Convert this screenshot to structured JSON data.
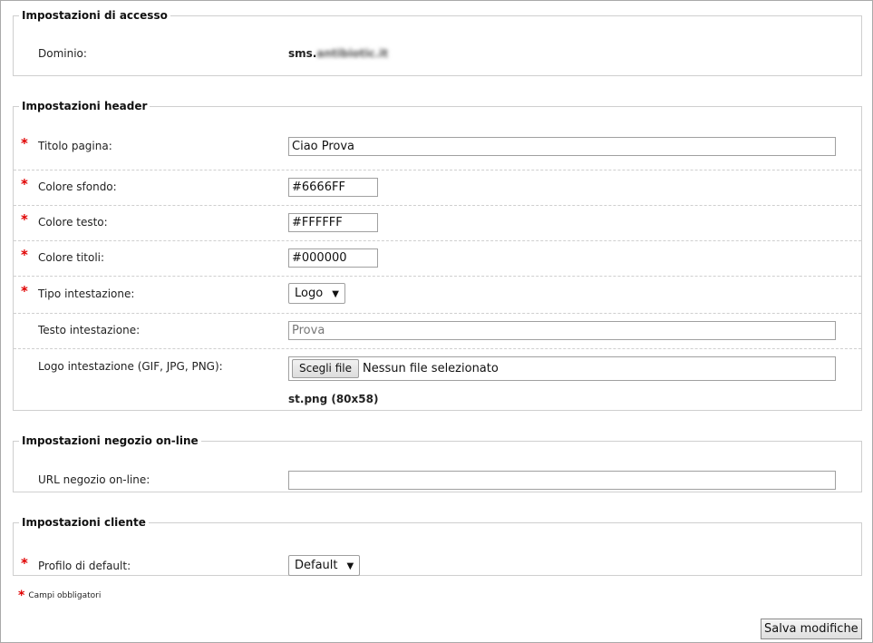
{
  "sections": {
    "access": {
      "legend": "Impostazioni di accesso",
      "domain_label": "Dominio:",
      "domain_value_prefix": "sms.",
      "domain_value_blurred": "antibiotic.it"
    },
    "header": {
      "legend": "Impostazioni header",
      "page_title": {
        "label": "Titolo pagina:",
        "value": "Ciao Prova",
        "required": true
      },
      "bg_color": {
        "label": "Colore sfondo:",
        "value": "#6666FF",
        "required": true
      },
      "text_color": {
        "label": "Colore testo:",
        "value": "#FFFFFF",
        "required": true
      },
      "titles_color": {
        "label": "Colore titoli:",
        "value": "#000000",
        "required": true
      },
      "header_type": {
        "label": "Tipo intestazione:",
        "selected": "Logo",
        "required": true
      },
      "header_text": {
        "label": "Testo intestazione:",
        "placeholder": "Prova",
        "required": false
      },
      "header_logo": {
        "label": "Logo intestazione (GIF, JPG, PNG):",
        "button_label": "Scegli file",
        "file_status": "Nessun file selezionato",
        "current_file": "st.png (80x58)",
        "required": false
      }
    },
    "shop": {
      "legend": "Impostazioni negozio on-line",
      "url": {
        "label": "URL negozio on-line:",
        "value": "",
        "required": false
      }
    },
    "client": {
      "legend": "Impostazioni cliente",
      "profile": {
        "label": "Profilo di default:",
        "selected": "Default",
        "required": true
      }
    }
  },
  "required_glyph": "*",
  "dropdown_glyph": "▼",
  "required_note": "Campi obbligatori",
  "save_label": "Salva modifiche",
  "colors": {
    "required": "#e00000",
    "border": "#cfcfcf"
  }
}
